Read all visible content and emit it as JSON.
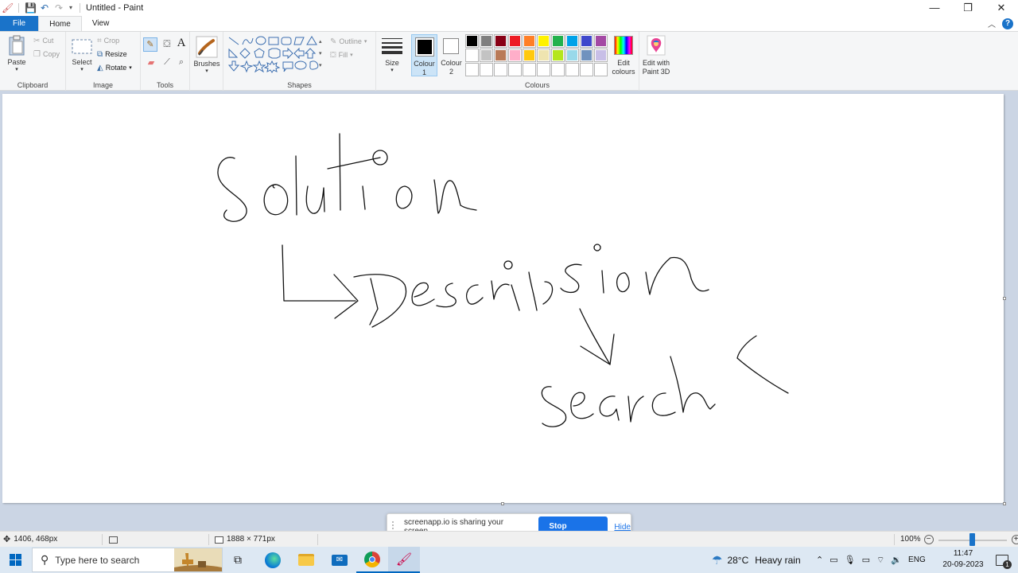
{
  "window": {
    "title": "Untitled - Paint",
    "minimize": "—",
    "restore": "❐",
    "close": "✕"
  },
  "tabs": [
    "File",
    "Home",
    "View"
  ],
  "ribbon": {
    "clipboard": {
      "group": "Clipboard",
      "paste": "Paste",
      "cut": "Cut",
      "copy": "Copy"
    },
    "image": {
      "group": "Image",
      "select": "Select",
      "crop": "Crop",
      "resize": "Resize",
      "rotate": "Rotate"
    },
    "tools": {
      "group": "Tools"
    },
    "brushes": {
      "label": "Brushes"
    },
    "shapes": {
      "group": "Shapes",
      "outline": "Outline",
      "fill": "Fill"
    },
    "size": {
      "label": "Size"
    },
    "colour1": {
      "line1": "Colour",
      "line2": "1"
    },
    "colour2": {
      "line1": "Colour",
      "line2": "2"
    },
    "colours": {
      "group": "Colours",
      "edit_line1": "Edit",
      "edit_line2": "colours",
      "paint3d_line1": "Edit with",
      "paint3d_line2": "Paint 3D",
      "palette_row1": [
        "#000000",
        "#7f7f7f",
        "#880015",
        "#ed1c24",
        "#ff7f27",
        "#fff200",
        "#22b14c",
        "#00a2e8",
        "#3f48cc",
        "#a349a4"
      ],
      "palette_row2": [
        "#ffffff",
        "#c3c3c3",
        "#b97a57",
        "#ffaec9",
        "#ffc90e",
        "#efe4b0",
        "#b5e61d",
        "#99d9ea",
        "#7092be",
        "#c8bfe7"
      ]
    }
  },
  "share_bar": {
    "message": "screenapp.io is sharing your screen.",
    "stop": "Stop sharing",
    "hide": "Hide"
  },
  "status": {
    "cursor_pos": "1406, 468px",
    "canvas_size": "1888 × 771px",
    "zoom": "100%",
    "zoom_level": 0.5
  },
  "taskbar": {
    "search_placeholder": "Type here to search",
    "weather_temp": "28°C",
    "weather_desc": "Heavy rain",
    "lang": "ENG",
    "time": "11:47",
    "date": "20-09-2023",
    "notif_count": "1"
  }
}
